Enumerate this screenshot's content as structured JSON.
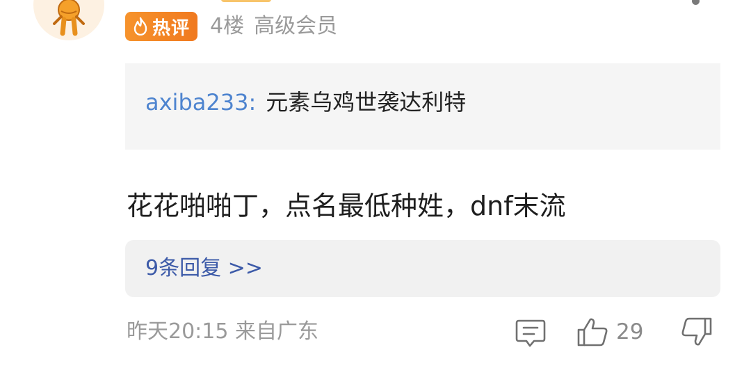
{
  "comment": {
    "hot_badge": "热评",
    "floor": "4楼",
    "member_level": "高级会员",
    "quote": {
      "user": "axiba233:",
      "text": "元素乌鸡世袭达利特"
    },
    "body": "花花啪啪丁，点名最低种姓，dnf末流",
    "replies_link": "9条回复 >>",
    "time_location": "昨天20:15 来自广东",
    "like_count": "29"
  },
  "icons": {
    "avatar": "avatar-image",
    "hot": "fire-icon",
    "more": "more-icon",
    "comment": "comment-icon",
    "like": "thumbs-up-icon",
    "dislike": "thumbs-down-icon"
  },
  "colors": {
    "badge": "#f08a24",
    "username_link": "#4e84cf",
    "reply_link": "#3c5aa8",
    "meta_text": "#9a9a9a"
  }
}
